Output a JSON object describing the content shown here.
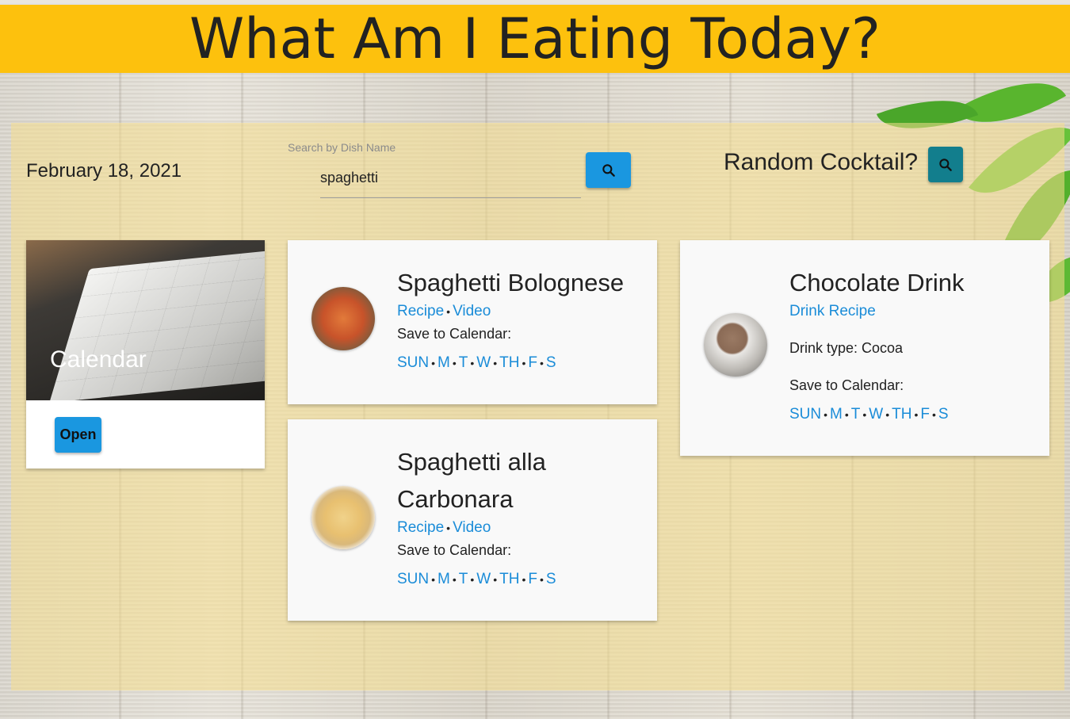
{
  "header": {
    "title": "What Am I Eating Today?"
  },
  "date": "February 18, 2021",
  "search": {
    "label": "Search by Dish Name",
    "value": "spaghetti"
  },
  "cocktail": {
    "label": "Random Cocktail?"
  },
  "calendar_card": {
    "title": "Calendar",
    "open_label": "Open"
  },
  "dishes": [
    {
      "title": "Spaghetti Bolognese",
      "recipe_label": "Recipe",
      "video_label": "Video",
      "save_label": "Save to Calendar:"
    },
    {
      "title": "Spaghetti alla Carbonara",
      "recipe_label": "Recipe",
      "video_label": "Video",
      "save_label": "Save to Calendar:"
    }
  ],
  "drink": {
    "title": "Chocolate Drink",
    "recipe_label": "Drink Recipe",
    "type_text": "Drink type: Cocoa",
    "save_label": "Save to Calendar:"
  },
  "days": [
    "SUN",
    "M",
    "T",
    "W",
    "TH",
    "F",
    "S"
  ],
  "colors": {
    "header": "#fdc10d",
    "link": "#1a8cd8",
    "search_button": "#1a97e0",
    "cocktail_button": "#127e8d"
  },
  "icons": {
    "search": "search-icon"
  }
}
